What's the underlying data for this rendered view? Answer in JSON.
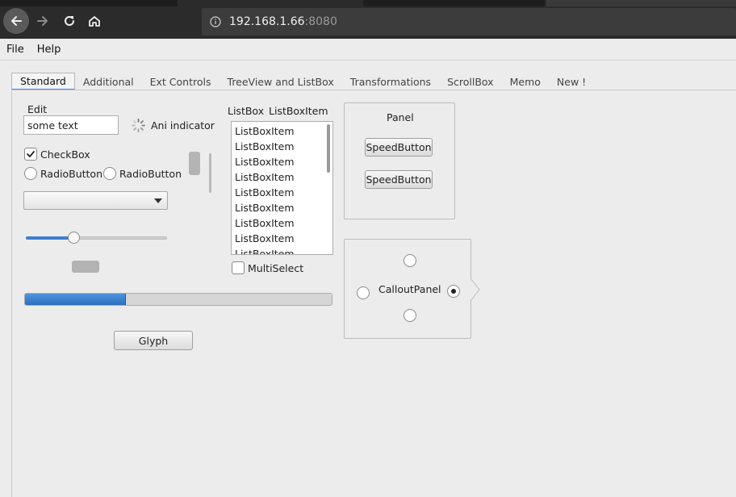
{
  "browser": {
    "url_host": "192.168.1.66",
    "url_port": ":8080",
    "icons": [
      "back-arrow-icon",
      "forward-arrow-icon",
      "reload-icon",
      "home-icon",
      "info-icon"
    ]
  },
  "menu": {
    "items": [
      "File",
      "Help"
    ]
  },
  "tabs": [
    {
      "label": "Standard",
      "active": true
    },
    {
      "label": "Additional"
    },
    {
      "label": "Ext Controls"
    },
    {
      "label": "TreeView and ListBox"
    },
    {
      "label": "Transformations"
    },
    {
      "label": "ScrollBox"
    },
    {
      "label": "Memo"
    },
    {
      "label": "New !"
    }
  ],
  "standard": {
    "edit_label": "Edit",
    "edit_value": "some text",
    "ani_indicator_label": "Ani indicator",
    "checkbox_label": "CheckBox",
    "checkbox_checked": true,
    "radio1_label": "RadioButton",
    "radio2_label": "RadioButton",
    "trackbar_value_fraction": 0.34,
    "progress_fraction": 0.33,
    "glyph_label": "Glyph",
    "listbox_label": "ListBox",
    "listboxitem_label": "ListBoxItem",
    "listbox_items": [
      "ListBoxItem",
      "ListBoxItem",
      "ListBoxItem",
      "ListBoxItem",
      "ListBoxItem",
      "ListBoxItem",
      "ListBoxItem",
      "ListBoxItem",
      "ListBoxItem"
    ],
    "multiselect_label": "MultiSelect",
    "panel_label": "Panel",
    "speedbutton1_label": "SpeedButton",
    "speedbutton2_label": "SpeedButton",
    "callout_label": "CalloutPanel"
  },
  "colors": {
    "accent": "#3d8ee0",
    "progress": "#3d7fd0",
    "chrome": "#2b2b2b"
  }
}
